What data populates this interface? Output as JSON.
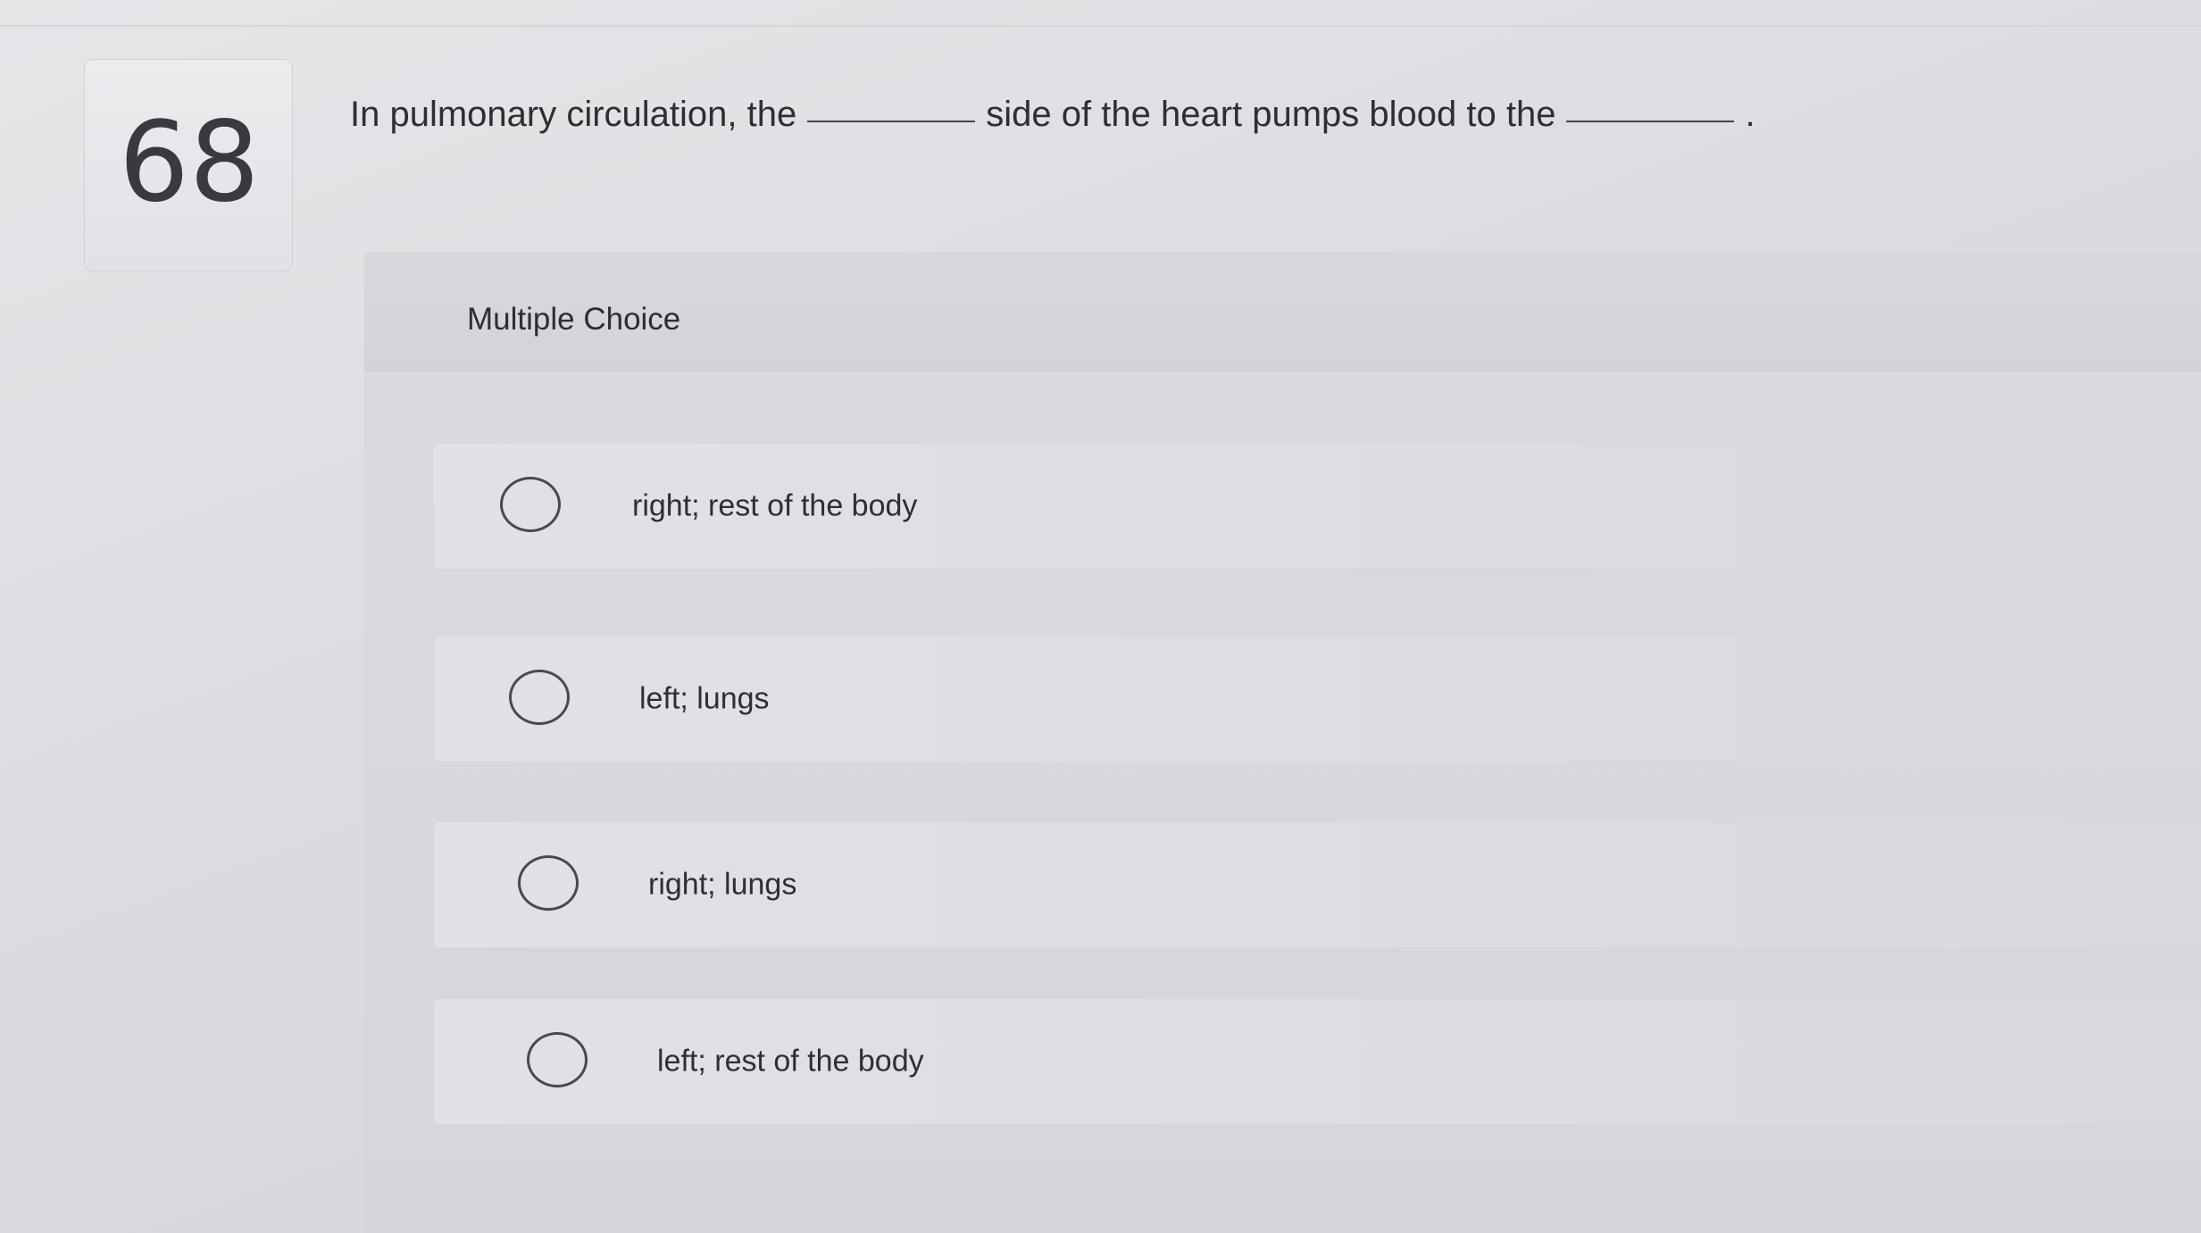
{
  "question": {
    "number": "68",
    "prompt_part1": "In pulmonary circulation, the",
    "prompt_part2": "side of the heart pumps blood to the",
    "prompt_end": "."
  },
  "section": {
    "type_label": "Multiple Choice"
  },
  "options": [
    {
      "label": "right; rest of the body",
      "selected": false
    },
    {
      "label": "left; lungs",
      "selected": false
    },
    {
      "label": "right; lungs",
      "selected": false
    },
    {
      "label": "left; rest of the body",
      "selected": false
    }
  ],
  "icons": {
    "radio": "radio-unselected-icon"
  }
}
